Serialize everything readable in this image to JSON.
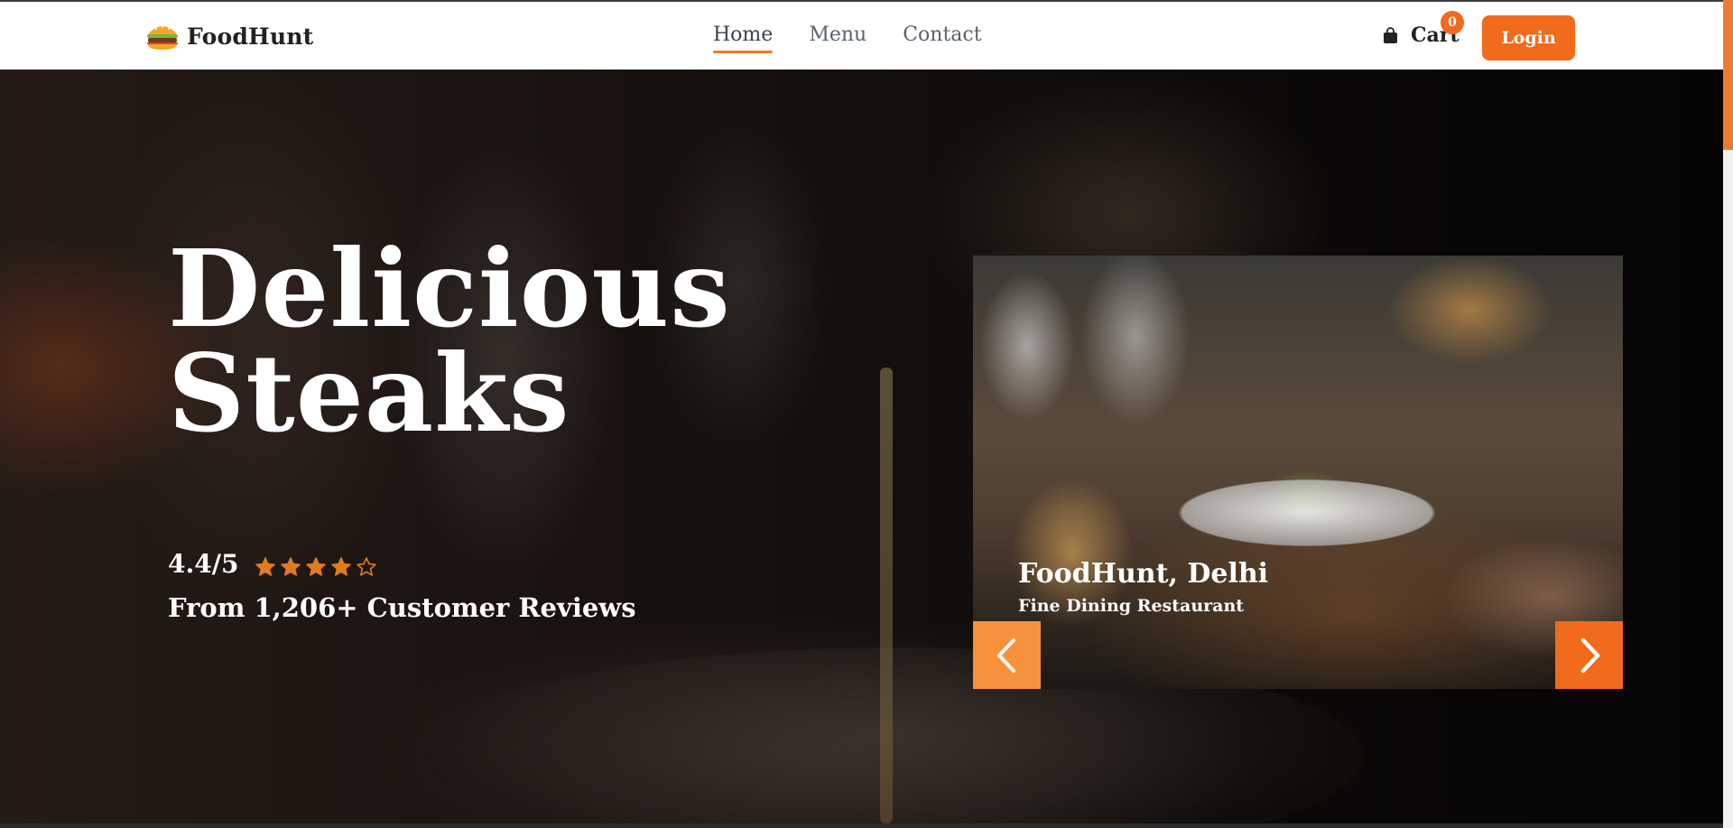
{
  "nav": {
    "brand": "FoodHunt",
    "links": [
      {
        "label": "Home",
        "active": true
      },
      {
        "label": "Menu",
        "active": false
      },
      {
        "label": "Contact",
        "active": false
      }
    ],
    "cart_label": "Cart",
    "cart_count": "0",
    "login_label": "Login"
  },
  "hero": {
    "title_line1": "Delicious",
    "title_line2": "Steaks",
    "rating_value": "4.4/5",
    "rating_stars": 4,
    "rating_max": 5,
    "reviews_text": "From 1,206+ Customer Reviews"
  },
  "carousel": {
    "title": "FoodHunt, Delhi",
    "subtitle": "Fine Dining Restaurant"
  },
  "colors": {
    "accent": "#f26a1b",
    "accent_light": "#f7913b",
    "star": "#e07b1f"
  },
  "icons": {
    "logo": "burger-icon",
    "cart": "shopping-bag-icon",
    "prev": "chevron-left-icon",
    "next": "chevron-right-icon"
  }
}
